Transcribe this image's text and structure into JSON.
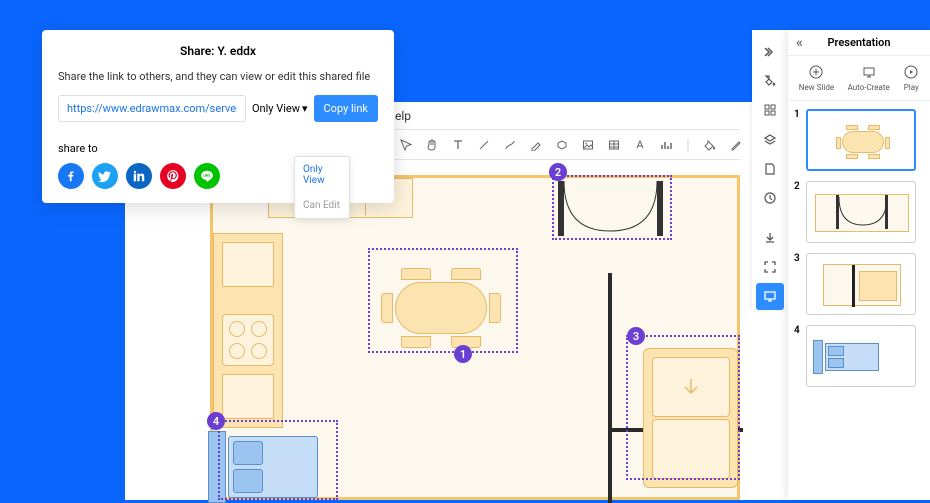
{
  "menu": {
    "help": "elp"
  },
  "share": {
    "title": "Share: Y. eddx",
    "desc": "Share the link to others, and they can view or edit this shared file",
    "url": "https://www.edrawmax.com/server...",
    "perm_label": "Only View",
    "copy_label": "Copy link",
    "share_to_label": "share to",
    "options": {
      "only_view": "Only View",
      "can_edit": "Can Edit"
    },
    "social": {
      "facebook": "facebook-icon",
      "twitter": "twitter-icon",
      "linkedin": "linkedin-icon",
      "pinterest": "pinterest-icon",
      "line": "line-icon"
    }
  },
  "presentation": {
    "title": "Presentation",
    "actions": {
      "new_slide": "New Slide",
      "auto_create": "Auto-Create",
      "play": "Play"
    },
    "slides": {
      "s1": "1",
      "s2": "2",
      "s3": "3",
      "s4": "4"
    }
  },
  "markers": {
    "m1": "1",
    "m2": "2",
    "m3": "3",
    "m4": "4"
  },
  "colors": {
    "accent": "#2d8cff",
    "purple": "#6b3fd4",
    "orange": "#f5c46b"
  }
}
